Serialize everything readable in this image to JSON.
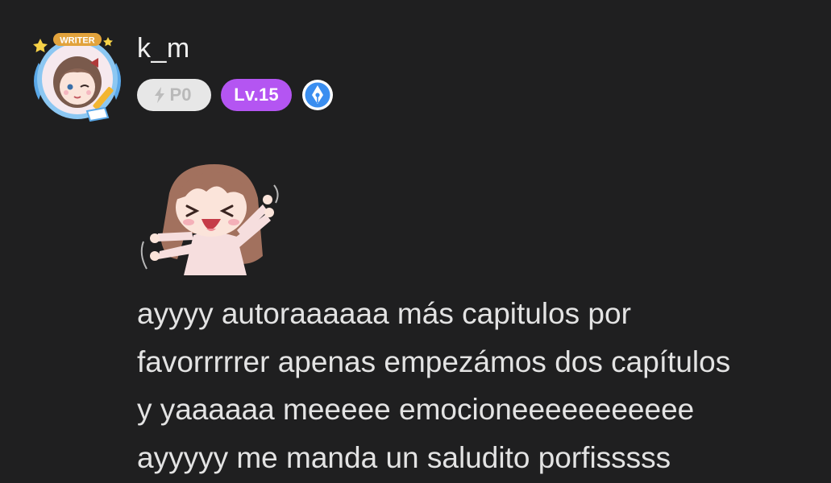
{
  "comment": {
    "username": "k_m",
    "avatar": {
      "frame_label": "WRITER",
      "icon": "avatar-writer-frame-icon"
    },
    "badges": {
      "points": {
        "icon": "lightning-bolt-icon",
        "label": "P0"
      },
      "level": {
        "label": "Lv.15",
        "color": "#b455f2"
      },
      "writer_badge": {
        "icon": "pen-nib-icon",
        "color": "#3a8ef0"
      }
    },
    "sticker": {
      "icon": "happy-anime-girl-sticker"
    },
    "text_lines": [
      "ayyyy autoraaaaaa más capitulos por",
      "favorrrrrer apenas empezámos dos capítulos",
      "y yaaaaaa meeeee emocioneeeeeeeeeee",
      "ayyyyy me manda un saludito porfisssss"
    ]
  },
  "colors": {
    "background": "#1f1f20",
    "text": "#e3e3e3",
    "points_badge_bg": "#e7e7e7",
    "points_badge_text": "#b9b9b9"
  }
}
